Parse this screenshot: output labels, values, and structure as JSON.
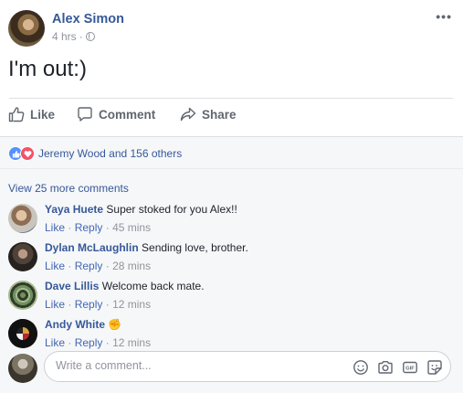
{
  "post": {
    "author": "Alex Simon",
    "time": "4 hrs",
    "dot": "·",
    "more": "•••",
    "text": "I'm out:)"
  },
  "actions": {
    "like": "Like",
    "comment": "Comment",
    "share": "Share"
  },
  "reactions": {
    "summary": "Jeremy Wood and 156 others"
  },
  "view_more": "View 25 more comments",
  "comments": [
    {
      "name": "Yaya Huete",
      "text": "Super stoked for you Alex!!",
      "like": "Like",
      "reply": "Reply",
      "time": "45 mins",
      "dot": "·"
    },
    {
      "name": "Dylan McLaughlin",
      "text": "Sending love, brother.",
      "like": "Like",
      "reply": "Reply",
      "time": "28 mins",
      "dot": "·"
    },
    {
      "name": "Dave Lillis",
      "text": "Welcome back mate.",
      "like": "Like",
      "reply": "Reply",
      "time": "12 mins",
      "dot": "·"
    },
    {
      "name": "Andy White",
      "text": "✊",
      "like": "Like",
      "reply": "Reply",
      "time": "12 mins",
      "dot": "·"
    }
  ],
  "composer": {
    "placeholder": "Write a comment..."
  },
  "colors": {
    "link": "#365899",
    "muted": "#90949c",
    "like_blue": "#5890ff",
    "love_red": "#f25268"
  }
}
